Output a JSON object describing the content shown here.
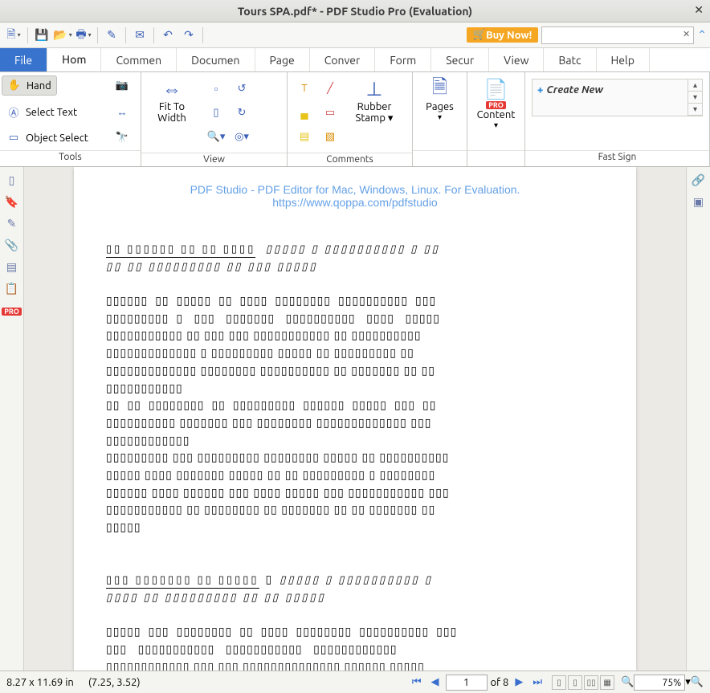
{
  "window": {
    "title": "Tours SPA.pdf* - PDF Studio Pro (Evaluation)"
  },
  "buy_now": "Buy Now!",
  "menu": {
    "file": "File",
    "home": "Hom",
    "comment": "Commen",
    "document": "Documen",
    "page": "Page",
    "convert": "Conver",
    "form": "Form",
    "secure": "Secur",
    "view": "View",
    "batch": "Batc",
    "help": "Help"
  },
  "ribbon": {
    "tools": {
      "hand": "Hand",
      "select_text": "Select Text",
      "object_select": "Object Select",
      "label": "Tools"
    },
    "view": {
      "fit_to_width": "Fit To Width",
      "label": "View"
    },
    "comments": {
      "rubber_stamp": "Rubber Stamp",
      "label": "Comments"
    },
    "pages": {
      "title": "Pages"
    },
    "content": {
      "title": "Content",
      "pro": "PRO"
    },
    "fast_sign": {
      "create_new": "Create New",
      "label": "Fast Sign"
    }
  },
  "watermark": "PDF Studio - PDF Editor for Mac, Windows, Linux. For Evaluation. https://www.qoppa.com/pdfstudio",
  "status": {
    "page_size": "8.27 x 11.69 in",
    "cursor": "(7.25, 3.52)",
    "page_current": "1",
    "page_total": "of 8",
    "zoom": "75%"
  }
}
